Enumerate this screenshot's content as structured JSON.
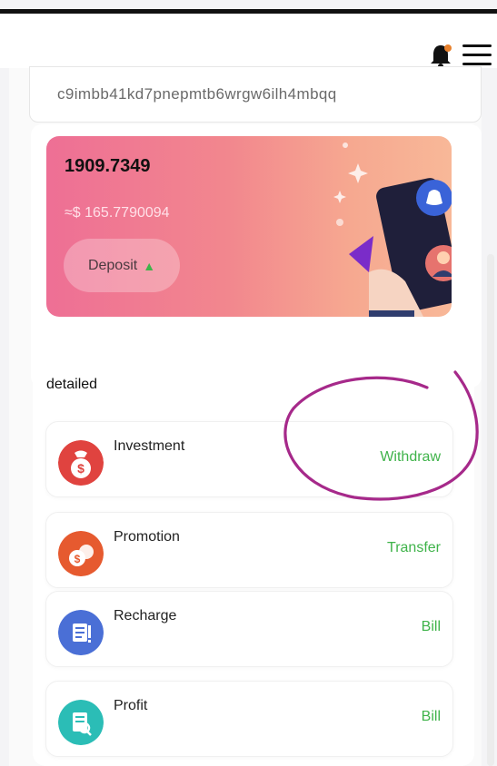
{
  "header": {
    "bell_icon": "bell-icon",
    "menu_icon": "hamburger-menu-icon"
  },
  "wallet": {
    "address": "c9imbb41kd7pnepmtb6wrgw6ilh4mbqq",
    "balance": "1909.7349",
    "usd_value": "≈$ 165.7790094",
    "deposit_label": "Deposit"
  },
  "detailed": {
    "title": "detailed",
    "items": [
      {
        "label": "Investment",
        "action": "Withdraw",
        "icon": "money-bag-icon",
        "color": "#e0433f"
      },
      {
        "label": "Promotion",
        "action": "Transfer",
        "icon": "money-bags-icon",
        "color": "#e65a2f"
      },
      {
        "label": "Recharge",
        "action": "Bill",
        "icon": "document-icon",
        "color": "#4a6fd6"
      },
      {
        "label": "Profit",
        "action": "Bill",
        "icon": "document-search-icon",
        "color": "#2bbdb6"
      }
    ]
  },
  "colors": {
    "accent_green": "#3fb34a",
    "card_gradient_start": "#ee6f95",
    "card_gradient_end": "#f8b898",
    "annotation_circle": "#a6298a"
  }
}
